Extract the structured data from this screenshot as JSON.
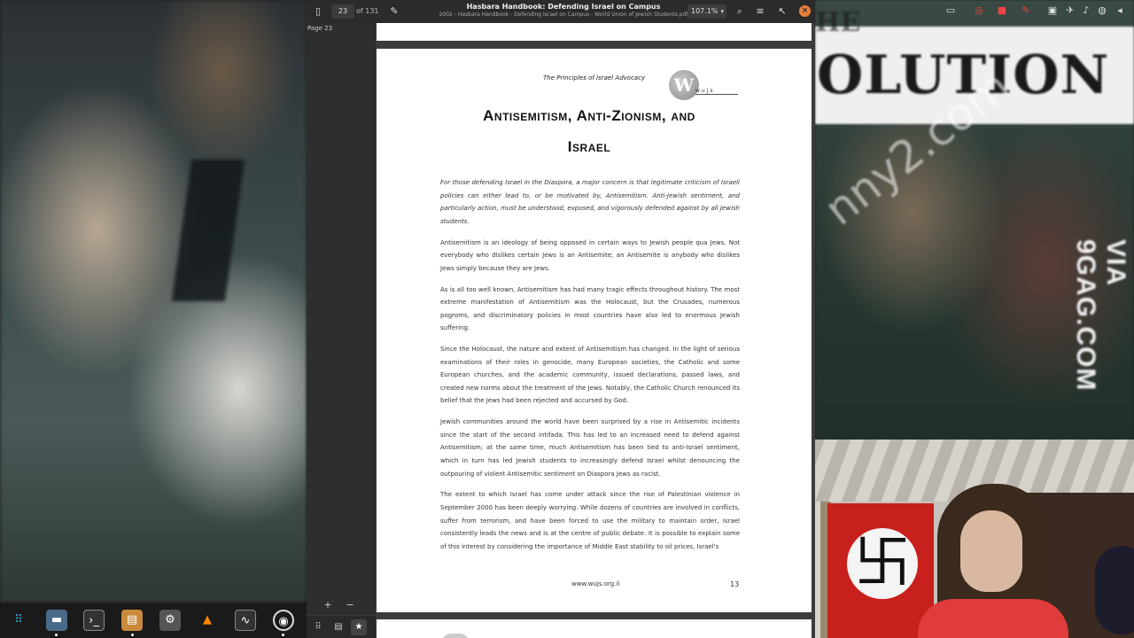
{
  "viewer": {
    "current_page": "23",
    "page_total": "of 131",
    "title": "Hasbara Handbook: Defending Israel on Campus",
    "subtitle": "2002 - Hasbara Handbook - Defending Israel on Campus - World Union of Jewish Students.pdf",
    "zoom": "107.1%",
    "sidebar_label": "Page 23",
    "zoom_in": "+",
    "zoom_out": "−"
  },
  "document": {
    "header": "The Principles of Israel Advocacy",
    "logo_letter": "W",
    "logo_text": "wujs",
    "title_line1": "Antisemitism, Anti-Zionism, and",
    "title_line2": "Israel",
    "paragraphs": [
      "For those defending Israel in the Diaspora, a major concern is that legitimate criticism of Israeli policies can either lead to, or be motivated by, Antisemitism. Anti-Jewish sentiment, and particularly action, must be understood, exposed, and vigorously defended against by all Jewish students.",
      "Antisemitism is an ideology of being opposed in certain ways to Jewish people qua Jews. Not everybody who dislikes certain Jews is an Antisemite; an Antisemite is anybody who dislikes Jews simply because they are Jews.",
      "As is all too well known, Antisemitism has had many tragic effects throughout history. The most extreme manifestation of Antisemitism was the Holocaust, but the Crusades, numerous pogroms, and discriminatory policies in most countries have also led to enormous Jewish suffering.",
      "Since the Holocaust, the nature and extent of Antisemitism has changed. In the light of serious examinations of their roles in genocide, many European societies, the Catholic and some European churches, and the academic community, issued declarations, passed laws, and created new norms about the treatment of the Jews. Notably, the Catholic Church renounced its belief that the Jews had been rejected and accursed by God.",
      "Jewish communities around the world have been surprised by a rise in Antisemitic incidents since the start of the second intifada. This has led to an increased need to defend against Antisemitism; at the same time, much Antisemitism has been tied to anti-Israel sentiment, which in turn has led Jewish students to increasingly defend Israel whilst denouncing the outpouring of violent Antisemitic sentiment on Diaspora Jews as racist.",
      "The extent to which Israel has come under attack since the rise of Palestinian violence in September 2000 has been deeply worrying. While dozens of countries are involved in conflicts, suffer from terrorism, and have been forced to use the military to maintain order, Israel consistently leads the news and is at the centre of public debate. It is possible to explain some of this interest by considering the importance of Middle East stability to oil prices, Israel's"
    ],
    "footer_url": "www.wujs.org.il",
    "page_number": "13"
  },
  "background": {
    "banner_top": "HE",
    "banner_text": "OLUTION",
    "watermark": "nny2.com",
    "via_text": "VIA 9GAG.COM",
    "flag_symbol": "卐"
  },
  "icons": {
    "sidebar_toggle": "▯",
    "pencil": "✎",
    "search": "⌕",
    "menu": "≡",
    "close": "×",
    "grid": "⠿",
    "comment": "▤",
    "star": "★"
  },
  "colors": {
    "accent": "#e8803c",
    "flag_red": "#c8201c",
    "shirt_red": "#e03c3c"
  }
}
